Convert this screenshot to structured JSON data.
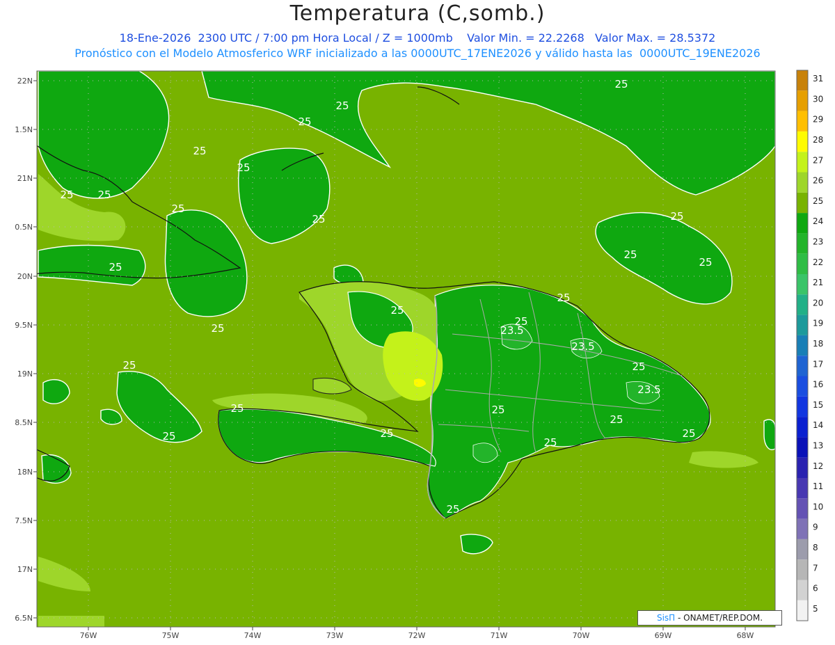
{
  "title": "Temperatura (C,somb.)",
  "subtitle_line1": "18-Ene-2026  2300 UTC / 7:00 pm Hora Local / Z = 1000mb    Valor Min. = 22.2268   Valor Max. = 28.5372",
  "subtitle_line2": "Pronóstico con el Modelo Atmosferico WRF inicializado a las 0000UTC_17ENE2026 y válido hasta las  0000UTC_19ENE2026",
  "credit": {
    "brand": "SisΠ",
    "org": " - ONAMET/REP.DOM."
  },
  "lat_labels": [
    "22N",
    "1.5N",
    "21N",
    "0.5N",
    "20N",
    "9.5N",
    "19N",
    "8.5N",
    "18N",
    "7.5N",
    "17N",
    "6.5N"
  ],
  "lon_labels": [
    "76W",
    "75W",
    "74W",
    "73W",
    "72W",
    "71W",
    "70W",
    "69W",
    "68W"
  ],
  "colorbar": {
    "levels": [
      "31",
      "30",
      "29",
      "28",
      "27",
      "26",
      "25",
      "24",
      "23",
      "22",
      "21",
      "20",
      "19",
      "18",
      "17",
      "16",
      "15",
      "14",
      "13",
      "12",
      "11",
      "10",
      "9",
      "8",
      "7",
      "6",
      "5"
    ],
    "colors": [
      "#c8820a",
      "#e69f00",
      "#ffbf00",
      "#fffb00",
      "#c4f21a",
      "#9ed62a",
      "#78b300",
      "#0fa810",
      "#23b42a",
      "#2fbd45",
      "#3ac468",
      "#22b087",
      "#1d9a9b",
      "#197fb6",
      "#1f64d2",
      "#1a4ee0",
      "#1236e0",
      "#0a20d0",
      "#0a12b8",
      "#2a22b0",
      "#4838b2",
      "#6452b4",
      "#7f72b6",
      "#9c9cac",
      "#b6b6b6",
      "#d2d2d2",
      "#f2f2f2"
    ]
  },
  "contour_labels": [
    "25",
    "25",
    "25",
    "25",
    "25",
    "25",
    "25",
    "25",
    "25",
    "25",
    "25",
    "25",
    "25",
    "25",
    "25",
    "25",
    "23.5",
    "23.5",
    "25",
    "25",
    "23.5",
    "25",
    "25",
    "25",
    "25",
    "25",
    "25",
    "25",
    "25",
    "25"
  ],
  "legend": {
    "field_color": "#78b300",
    "cool_color": "#0fa810",
    "warm_color": "#9ed62a",
    "hot_color": "#c4f21a"
  }
}
